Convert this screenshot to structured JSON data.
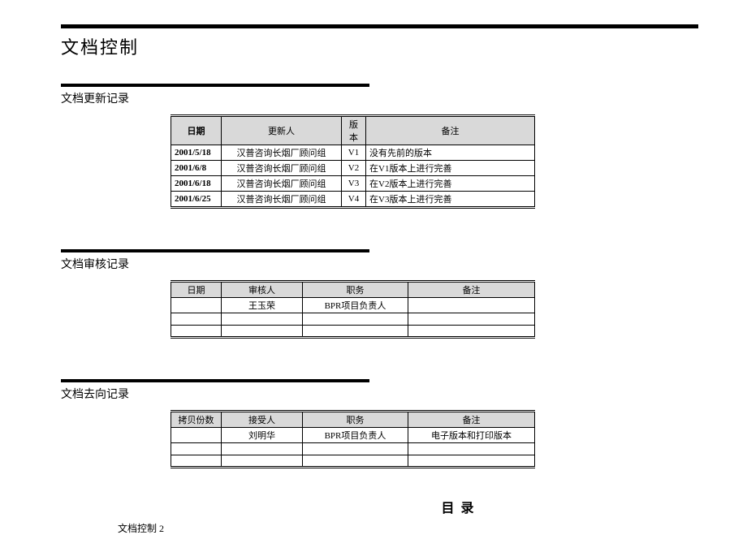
{
  "docTitle": "文档控制",
  "section1": {
    "title": "文档更新记录",
    "headers": {
      "date": "日期",
      "updater": "更新人",
      "version": "版本",
      "remark": "备注"
    },
    "rows": [
      {
        "date": "2001/5/18",
        "updater": "汉普咨询长烟厂顾问组",
        "version": "V1",
        "remark": "没有先前的版本"
      },
      {
        "date": "2001/6/8",
        "updater": "汉普咨询长烟厂顾问组",
        "version": "V2",
        "remark": "在V1版本上进行完善"
      },
      {
        "date": "2001/6/18",
        "updater": "汉普咨询长烟厂顾问组",
        "version": "V3",
        "remark": "在V2版本上进行完善"
      },
      {
        "date": "2001/6/25",
        "updater": "汉普咨询长烟厂顾问组",
        "version": "V4",
        "remark": "在V3版本上进行完善"
      }
    ]
  },
  "section2": {
    "title": "文档审核记录",
    "headers": {
      "date": "日期",
      "reviewer": "审核人",
      "role": "职务",
      "remark": "备注"
    },
    "rows": [
      {
        "date": "",
        "reviewer": "王玉荣",
        "role": "BPR项目负责人",
        "remark": ""
      },
      {
        "date": "",
        "reviewer": "",
        "role": "",
        "remark": ""
      },
      {
        "date": "",
        "reviewer": "",
        "role": "",
        "remark": ""
      }
    ]
  },
  "section3": {
    "title": "文档去向记录",
    "headers": {
      "copies": "拷贝份数",
      "receiver": "接受人",
      "role": "职务",
      "remark": "备注"
    },
    "rows": [
      {
        "copies": "",
        "receiver": "刘明华",
        "role": "BPR项目负责人",
        "remark": "电子版本和打印版本"
      },
      {
        "copies": "",
        "receiver": "",
        "role": "",
        "remark": ""
      },
      {
        "copies": "",
        "receiver": "",
        "role": "",
        "remark": ""
      }
    ]
  },
  "toc": {
    "title": "目录",
    "entry": "文档控制 2"
  }
}
